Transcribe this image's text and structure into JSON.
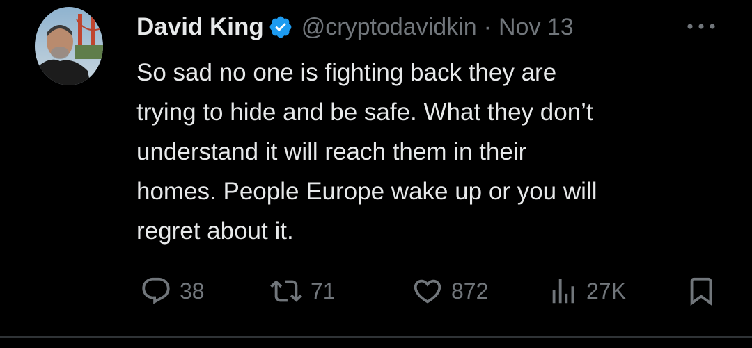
{
  "tweet": {
    "author_name": "David King",
    "handle": "@cryptodavidkin",
    "separator": "·",
    "date": "Nov 13",
    "text_lines": [
      "So sad no one is fighting back they are",
      "trying to hide and be safe. What they don’t",
      "understand it will reach them in their",
      "homes. People Europe wake up or you will",
      "regret about it."
    ],
    "replies": "38",
    "retweets": "71",
    "likes": "872",
    "views": "27K"
  },
  "colors": {
    "background": "#000000",
    "text": "#e7e9ea",
    "muted": "#71767b",
    "verified": "#1d9bf0",
    "divider": "#2f3336"
  },
  "icons": [
    "avatar",
    "verified-badge-icon",
    "more-icon",
    "reply-icon",
    "retweet-icon",
    "like-icon",
    "views-icon",
    "bookmark-icon"
  ]
}
